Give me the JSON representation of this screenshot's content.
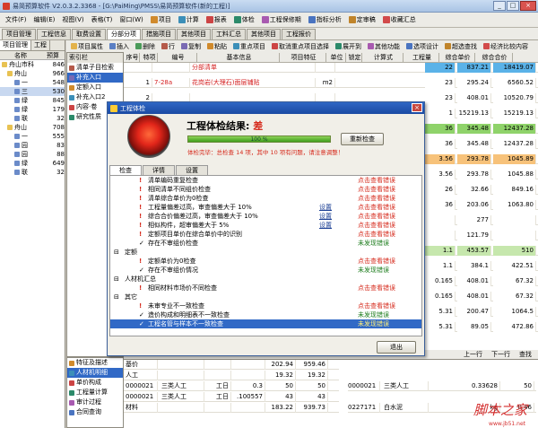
{
  "window": {
    "title": "易简预算软件 V2.0.3.2.3368 - [G:\\PaiMing\\PMSS\\易简预算软件(新的工程)]",
    "min": "_",
    "max": "□",
    "close": "×"
  },
  "menu": [
    {
      "label": "文件(F)",
      "icon": "file-icon"
    },
    {
      "label": "编辑(E)",
      "icon": "edit-icon"
    },
    {
      "label": "视图(V)",
      "icon": "view-icon"
    },
    {
      "label": "表格(T)",
      "icon": "table-icon"
    },
    {
      "label": "窗口(W)",
      "icon": "window-icon"
    },
    {
      "label": "项目",
      "icon": "project-icon"
    },
    {
      "label": "计算",
      "icon": "calc-icon"
    },
    {
      "label": "报表",
      "icon": "report-icon"
    },
    {
      "label": "体检",
      "icon": "check-icon"
    },
    {
      "label": "工程保修期",
      "icon": "warranty-icon"
    },
    {
      "label": "指标分析",
      "icon": "analysis-icon"
    },
    {
      "label": "定审稿",
      "icon": "review-icon"
    },
    {
      "label": "收藏汇总",
      "icon": "fav-icon"
    }
  ],
  "tabs": [
    "项目管理",
    "工程信息",
    "取费设置",
    "分部分项",
    "措施项目",
    "其他项目",
    "工料汇总",
    "其他项目",
    "工程报价"
  ],
  "left": {
    "tabs": [
      "项目管理",
      "工程"
    ],
    "header": [
      "名称",
      "预算"
    ],
    "tree": [
      {
        "name": "舟山市科",
        "val": "846"
      },
      {
        "name": "舟山",
        "val": "966"
      },
      {
        "name": "一",
        "val": "548"
      },
      {
        "name": "三",
        "val": "530"
      },
      {
        "name": "绿",
        "val": "845"
      },
      {
        "name": "绿",
        "val": "179"
      },
      {
        "name": "联",
        "val": "32"
      },
      {
        "name": "舟山",
        "val": "708"
      },
      {
        "name": "一",
        "val": "555"
      },
      {
        "name": "园",
        "val": "83"
      },
      {
        "name": "园",
        "val": "88"
      },
      {
        "name": "绿",
        "val": "649"
      },
      {
        "name": "联",
        "val": "32"
      }
    ]
  },
  "mid": {
    "header": "索引栏",
    "items": [
      "清单子目检索",
      "补充入口",
      "定额入口",
      "补充入口2",
      "内容·卷",
      "研究性质"
    ],
    "bottom": [
      "特征及描述",
      "人材机明细",
      "单价构成",
      "工程量计算",
      "审计过程",
      "合同查询"
    ]
  },
  "toolbar": {
    "items": [
      "项目属性",
      "插入",
      "删除",
      "行",
      "复制",
      "粘贴",
      "重点项目",
      "取消重点项目选择",
      "展开到",
      "其他功能",
      "选项设计",
      "超选查找",
      "经济比较内容"
    ],
    "sub": [
      "序号",
      "特项",
      "编号",
      "基本信息",
      "项目特征",
      "单位",
      "锁定",
      "计算式",
      "工程量",
      "综合单价",
      "综合合价"
    ]
  },
  "grid": {
    "rows": [
      {
        "seq": "",
        "code": "",
        "name": "分部清单",
        "unit": "",
        "qty": "22",
        "price": "837.21",
        "total": "18419.07"
      },
      {
        "seq": "1",
        "code": "7-28a",
        "name": "花岗岩(大理石)面层铺贴",
        "unit": "m2",
        "qty": "23",
        "price": "295.24",
        "total": "6560.52"
      },
      {
        "seq": "2",
        "code": "",
        "name": "",
        "unit": "",
        "qty": "23",
        "price": "408.01",
        "total": "10520.79"
      },
      {
        "seq": "3",
        "code": "",
        "name": "",
        "unit": "",
        "qty": "1",
        "price": "15219.13",
        "total": "15219.13"
      },
      {
        "seq": "",
        "code": "",
        "name": "",
        "unit": "",
        "qty": "36",
        "price": "345.48",
        "total": "12437.28"
      },
      {
        "seq": "",
        "code": "",
        "name": "",
        "unit": "",
        "qty": "36",
        "price": "345.48",
        "total": "12437.28"
      },
      {
        "seq": "",
        "code": "",
        "name": "",
        "unit": "",
        "qty": "3.56",
        "price": "293.78",
        "total": "1045.89"
      },
      {
        "seq": "",
        "code": "",
        "name": "",
        "unit": "",
        "qty": "3.56",
        "price": "293.78",
        "total": "1045.88"
      },
      {
        "seq": "",
        "code": "",
        "name": "",
        "unit": "",
        "qty": "26",
        "price": "32.66",
        "total": "849.16"
      },
      {
        "seq": "",
        "code": "",
        "name": "",
        "unit": "",
        "qty": "36",
        "price": "203.06",
        "total": "1063.80"
      },
      {
        "seq": "",
        "code": "",
        "name": "",
        "unit": "",
        "qty": "",
        "price": "277",
        "total": ""
      },
      {
        "seq": "",
        "code": "",
        "name": "",
        "unit": "",
        "qty": "",
        "price": "121.79",
        "total": ""
      },
      {
        "seq": "",
        "code": "",
        "name": "",
        "unit": "",
        "qty": "1.1",
        "price": "453.57",
        "total": "510"
      },
      {
        "seq": "",
        "code": "",
        "name": "",
        "unit": "",
        "qty": "1.1",
        "price": "384.1",
        "total": "422.51"
      },
      {
        "seq": "",
        "code": "",
        "name": "",
        "unit": "",
        "qty": "0.165",
        "price": "408.01",
        "total": "67.32"
      },
      {
        "seq": "",
        "code": "",
        "name": "",
        "unit": "",
        "qty": "0.165",
        "price": "408.01",
        "total": "67.32"
      },
      {
        "seq": "",
        "code": "",
        "name": "",
        "unit": "",
        "qty": "5.31",
        "price": "200.47",
        "total": "1064.5"
      },
      {
        "seq": "",
        "code": "",
        "name": "",
        "unit": "",
        "qty": "5.31",
        "price": "89.05",
        "total": "472.86"
      }
    ]
  },
  "dialog": {
    "title": "工程体检",
    "result_label": "工程体检结果:",
    "result_value": "差",
    "progress": "100 %",
    "progress_value": 1.0,
    "rerun": "重新检查",
    "summary": "体检完毕：总检查 14 项，其中 10 项有问题，请注意调整！",
    "tabs": [
      "检查",
      "详情",
      "设置"
    ],
    "exit": "退出",
    "items": [
      {
        "lvl": 2,
        "text": "清单编码重复检查",
        "status": "点击查看错误",
        "kind": "bad",
        "set": ""
      },
      {
        "lvl": 2,
        "text": "相同清单不同组价检查",
        "status": "点击查看错误",
        "kind": "bad",
        "set": ""
      },
      {
        "lvl": 2,
        "text": "清单综合单价为0检查",
        "status": "点击查看错误",
        "kind": "bad",
        "set": ""
      },
      {
        "lvl": 2,
        "text": "工程量偏差过高，审查偏差大于 10%",
        "status": "点击查看错误",
        "kind": "bad",
        "set": "设置"
      },
      {
        "lvl": 2,
        "text": "综合合价偏差过高，审查偏差大于 10%",
        "status": "点击查看错误",
        "kind": "bad",
        "set": "设置"
      },
      {
        "lvl": 2,
        "text": "相似构件，超审偏差大于 5%",
        "status": "点击查看错误",
        "kind": "bad",
        "set": "设置"
      },
      {
        "lvl": 2,
        "text": "定额项目单价在综合单价中的识别",
        "status": "点击查看错误",
        "kind": "bad",
        "set": ""
      },
      {
        "lvl": 2,
        "text": "存在不审组价检查",
        "status": "未发现错误",
        "kind": "ok",
        "set": ""
      },
      {
        "lvl": 1,
        "text": "定额",
        "status": "",
        "kind": "",
        "set": ""
      },
      {
        "lvl": 2,
        "text": "定额单价为0检查",
        "status": "点击查看错误",
        "kind": "bad",
        "set": ""
      },
      {
        "lvl": 2,
        "text": "存在不审组价情况",
        "status": "未发现错误",
        "kind": "ok",
        "set": ""
      },
      {
        "lvl": 1,
        "text": "人材机汇总",
        "status": "",
        "kind": "",
        "set": ""
      },
      {
        "lvl": 2,
        "text": "相同材料市场价不同检查",
        "status": "点击查看错误",
        "kind": "bad",
        "set": ""
      },
      {
        "lvl": 1,
        "text": "其它",
        "status": "",
        "kind": "",
        "set": ""
      },
      {
        "lvl": 2,
        "text": "未审专业不一致检查",
        "status": "点击查看错误",
        "kind": "bad",
        "set": ""
      },
      {
        "lvl": 2,
        "text": "造价构成和明细表不一致检查",
        "status": "未发现错误",
        "kind": "ok",
        "set": ""
      },
      {
        "lvl": 2,
        "text": "工程名管与样本不一致检查",
        "status": "未发现错误",
        "kind": "sel",
        "set": ""
      }
    ]
  },
  "bottom": {
    "nav": [
      "上一行",
      "下一行",
      "查找"
    ],
    "rows": [
      {
        "code": "基价",
        "name": "",
        "unit": "",
        "qty": "",
        "price": "202.94",
        "total": "959.46"
      },
      {
        "code": "人工",
        "name": "",
        "unit": "",
        "qty": "",
        "price": "19.32",
        "total": "19.32"
      },
      {
        "code": "0000021",
        "name": "三类人工",
        "unit": "工日",
        "qty": "0.3",
        "price": "50",
        "total": "50"
      },
      {
        "code": "0000021",
        "name": "三类人工",
        "unit": "工日",
        "qty": ".100557",
        "price": "43",
        "total": "43"
      },
      {
        "code": "材料",
        "name": "",
        "unit": "",
        "qty": "",
        "price": "183.22",
        "total": "939.73"
      }
    ],
    "right_rows": [
      {
        "code": "0000021",
        "name": "三类人工",
        "qty": "0.33628",
        "price": "50"
      },
      {
        "code": "0227171",
        "name": "白水泥",
        "qty": "kg",
        "price": "0.46"
      }
    ]
  },
  "watermark": "脚本之家",
  "watermark_url": "www.jb51.net"
}
